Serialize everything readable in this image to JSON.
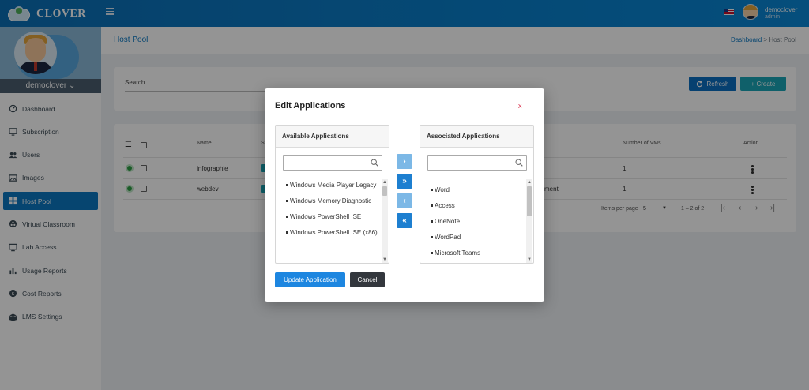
{
  "app": {
    "brand": "CLOVER",
    "brand_color": "#0b78c2"
  },
  "user": {
    "name": "democlover",
    "role": "admin",
    "profile_label": "democlover ⌄"
  },
  "sidebar": {
    "items": [
      {
        "label": "Dashboard",
        "icon": "dashboard-icon"
      },
      {
        "label": "Subscription",
        "icon": "monitor-icon"
      },
      {
        "label": "Users",
        "icon": "users-icon"
      },
      {
        "label": "Images",
        "icon": "image-icon"
      },
      {
        "label": "Host Pool",
        "icon": "grid-icon",
        "active": true
      },
      {
        "label": "Virtual Classroom",
        "icon": "classroom-icon"
      },
      {
        "label": "Lab Access",
        "icon": "desktop-icon"
      },
      {
        "label": "Usage Reports",
        "icon": "bar-chart-icon"
      },
      {
        "label": "Cost Reports",
        "icon": "dollar-icon"
      },
      {
        "label": "LMS Settings",
        "icon": "box-icon"
      }
    ]
  },
  "header": {
    "page_title": "Host Pool",
    "breadcrumb": {
      "home": "Dashboard",
      "separator": ">",
      "current": "Host Pool"
    }
  },
  "toolbar": {
    "search_label": "Search",
    "refresh_label": "Refresh",
    "create_label": "+ Create"
  },
  "table": {
    "columns": {
      "name": "Name",
      "status": "St",
      "vms": "Number of VMs",
      "action": "Action"
    },
    "rows": [
      {
        "name": "infographie",
        "vms": "1",
        "extra": ""
      },
      {
        "name": "webdev",
        "vms": "1",
        "extra": "ment"
      }
    ],
    "pagination": {
      "items_per_page_label": "Items per page",
      "items_per_page": "5",
      "range": "1 – 2 of 2"
    }
  },
  "modal": {
    "title": "Edit Applications",
    "close": "x",
    "available": {
      "header": "Available Applications",
      "search_placeholder": "",
      "items": [
        "Windows Media Player Legacy",
        "Windows Memory Diagnostic",
        "Windows PowerShell ISE",
        "Windows PowerShell ISE (x86)"
      ]
    },
    "associated": {
      "header": "Associated Applications",
      "search_placeholder": "",
      "items": [
        "Word",
        "Access",
        "OneNote",
        "WordPad",
        "Microsoft Teams"
      ]
    },
    "transfer_buttons": {
      "move_one_right": "›",
      "move_all_right": "»",
      "move_one_left": "‹",
      "move_all_left": "«"
    },
    "update_label": "Update Application",
    "cancel_label": "Cancel"
  }
}
